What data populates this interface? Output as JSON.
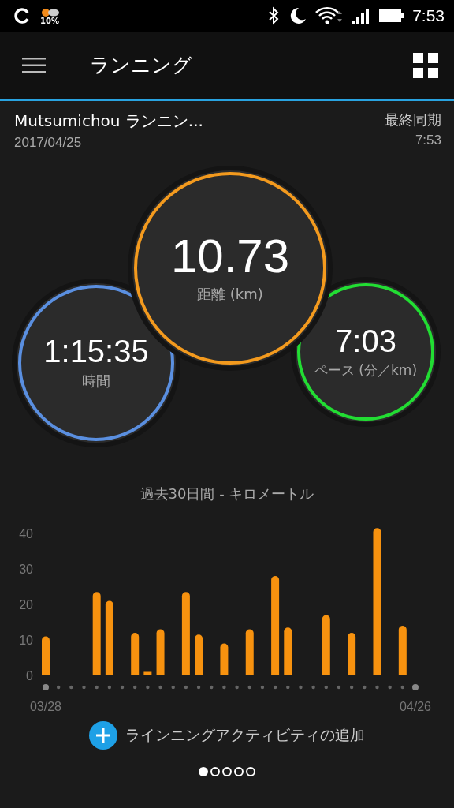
{
  "status_bar": {
    "weather": "10%",
    "time": "7:53"
  },
  "app_bar": {
    "title": "ランニング"
  },
  "activity": {
    "name": "Mutsumichou ランニン...",
    "date": "2017/04/25",
    "sync_label": "最終同期",
    "sync_time": "7:53"
  },
  "metrics": [
    {
      "kind": "left",
      "value": "1:15:35",
      "label": "時間",
      "color": "#5a8fe0"
    },
    {
      "kind": "right",
      "value": "7:03",
      "label": "ペース (分／km)",
      "color": "#22dd33"
    },
    {
      "kind": "center",
      "value": "10.73",
      "label": "距離 (km)",
      "color": "#f39a1e"
    }
  ],
  "chart": {
    "chart_data": {
      "type": "bar",
      "title": "過去30日間 - キロメートル",
      "categories": [
        "03/28",
        null,
        null,
        null,
        null,
        null,
        null,
        null,
        null,
        null,
        null,
        null,
        null,
        null,
        null,
        null,
        null,
        null,
        null,
        null,
        null,
        null,
        null,
        null,
        null,
        null,
        null,
        null,
        null,
        "04/26"
      ],
      "series": [
        {
          "color": "#f7920f",
          "values": [
            11,
            0,
            0,
            0,
            23.5,
            21,
            0,
            12,
            1,
            13,
            0,
            23.5,
            11.5,
            0,
            9,
            0,
            13,
            0,
            28,
            13.5,
            0,
            0,
            17,
            0,
            12,
            0,
            41.5,
            0,
            14,
            0
          ]
        }
      ],
      "ylim": [
        0,
        42
      ],
      "yticks": [
        0,
        10,
        20,
        30,
        40
      ]
    }
  },
  "add_button": {
    "label": "ラインニングアクティビティの追加"
  },
  "pager": [
    {
      "selected": true
    },
    {
      "selected": false
    },
    {
      "selected": false
    },
    {
      "selected": false
    },
    {
      "selected": false
    }
  ]
}
